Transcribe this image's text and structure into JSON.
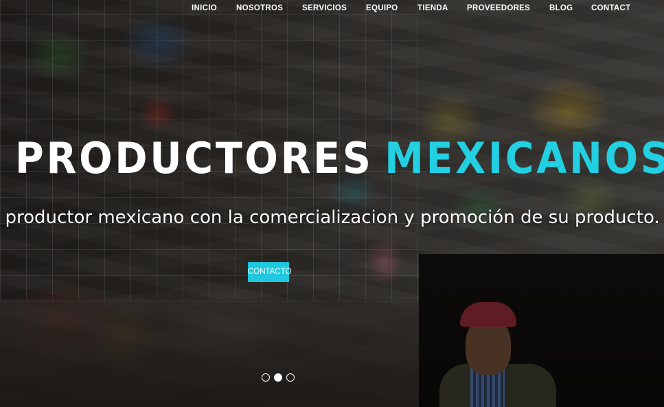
{
  "nav": {
    "items": [
      {
        "label": "INICIO"
      },
      {
        "label": "NOSOTROS"
      },
      {
        "label": "SERVICIOS"
      },
      {
        "label": "EQUIPO"
      },
      {
        "label": "TIENDA"
      },
      {
        "label": "PROVEEDORES"
      },
      {
        "label": "BLOG"
      },
      {
        "label": "CONTACT"
      }
    ]
  },
  "hero": {
    "headline_part1": "PRODUCTORES",
    "headline_part2": "MEXICANOS",
    "subtitle": "l productor mexicano con la comercializacion y promoción de su producto.",
    "cta_label": "CONTACTO",
    "slider": {
      "slide_count": 3,
      "active_slide": 2
    }
  },
  "colors": {
    "accent": "#22d0e2",
    "button": "#1fc8de",
    "text": "#ffffff"
  }
}
